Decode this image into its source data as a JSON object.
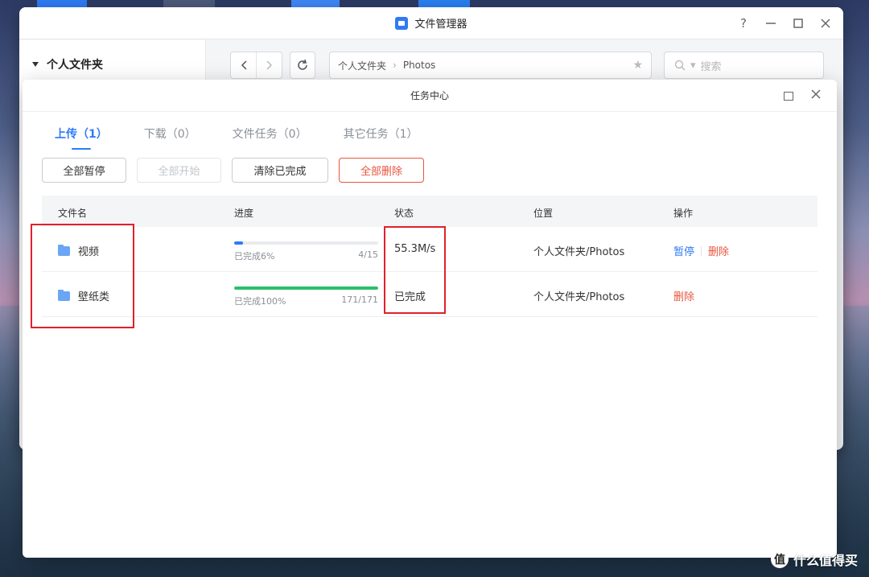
{
  "file_manager": {
    "title": "文件管理器",
    "help": "?",
    "sidebar_title": "个人文件夹",
    "path": [
      "个人文件夹",
      "Photos"
    ],
    "search_placeholder": "搜索"
  },
  "task_center": {
    "title": "任务中心",
    "tabs": [
      {
        "label": "上传（1）",
        "active": true
      },
      {
        "label": "下载（0）",
        "active": false
      },
      {
        "label": "文件任务（0）",
        "active": false
      },
      {
        "label": "其它任务（1）",
        "active": false
      }
    ],
    "buttons": {
      "pause_all": "全部暂停",
      "start_all": "全部开始",
      "clear_done": "清除已完成",
      "delete_all": "全部删除"
    },
    "columns": {
      "name": "文件名",
      "progress": "进度",
      "status": "状态",
      "location": "位置",
      "actions": "操作"
    },
    "rows": [
      {
        "name": "视频",
        "progress_text": "已完成6%",
        "progress_fraction": 0.06,
        "count": "4/15",
        "status": "55.3M/s",
        "location": "个人文件夹/Photos",
        "pause": "暂停",
        "delete": "删除"
      },
      {
        "name": "壁纸类",
        "progress_text": "已完成100%",
        "progress_fraction": 1.0,
        "count": "171/171",
        "status": "已完成",
        "location": "个人文件夹/Photos",
        "delete": "删除"
      }
    ]
  },
  "watermark": {
    "logo": "值",
    "text": "什么值得买"
  },
  "colors": {
    "accent": "#2f7bf5",
    "danger": "#e8553e",
    "success": "#2bbf6a",
    "highlight": "#e0212b"
  }
}
